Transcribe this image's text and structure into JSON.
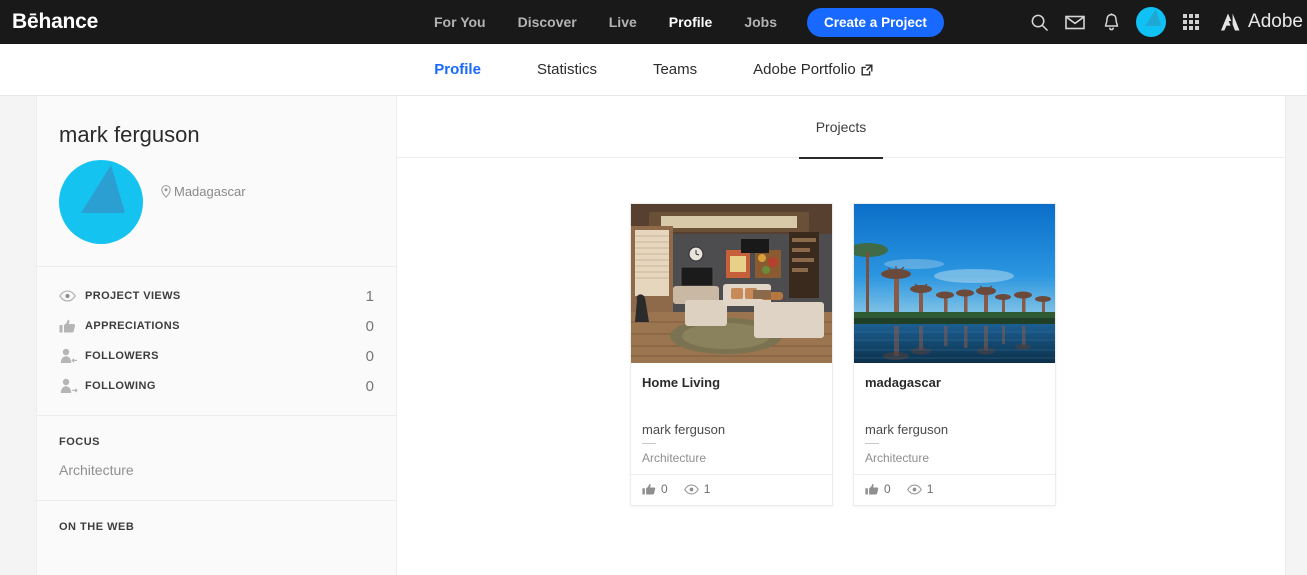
{
  "topnav": {
    "brand": "Bēhance",
    "links": [
      {
        "label": "For You"
      },
      {
        "label": "Discover"
      },
      {
        "label": "Live"
      },
      {
        "label": "Profile"
      },
      {
        "label": "Jobs"
      }
    ],
    "create_button": "Create a Project",
    "icons": {
      "search": "search-icon",
      "mail": "mail-icon",
      "bell": "bell-icon",
      "avatar": "user-avatar",
      "apps": "apps-grid-icon"
    },
    "adobe_label": "Adobe",
    "accent_blue": "#1769ff",
    "bar_color": "#191919"
  },
  "subnav": {
    "items": [
      {
        "label": "Profile",
        "active": true
      },
      {
        "label": "Statistics",
        "active": false
      },
      {
        "label": "Teams",
        "active": false
      },
      {
        "label": "Adobe Portfolio",
        "active": false,
        "external": true
      }
    ],
    "active_color": "#1769ff"
  },
  "sidebar": {
    "profile": {
      "name": "mark ferguson",
      "location": "Madagascar",
      "avatar_color": "#15c3f0"
    },
    "stats": [
      {
        "icon": "eye-icon",
        "label": "PROJECT VIEWS",
        "value": "1"
      },
      {
        "icon": "thumbs-up-icon",
        "label": "APPRECIATIONS",
        "value": "0"
      },
      {
        "icon": "follower-icon",
        "label": "FOLLOWERS",
        "value": "0"
      },
      {
        "icon": "following-icon",
        "label": "FOLLOWING",
        "value": "0"
      }
    ],
    "focus": {
      "title": "FOCUS",
      "value": "Architecture"
    },
    "on_the_web": {
      "title": "ON THE WEB"
    }
  },
  "content": {
    "tabs": [
      {
        "label": "Projects",
        "active": true
      }
    ],
    "cards": [
      {
        "title": "Home Living",
        "owner": "mark ferguson",
        "field": "Architecture",
        "appreciations": "0",
        "views": "1",
        "thumb": "interior-living-room"
      },
      {
        "title": "madagascar",
        "owner": "mark ferguson",
        "field": "Architecture",
        "appreciations": "0",
        "views": "1",
        "thumb": "baobab-trees-landscape"
      }
    ]
  }
}
